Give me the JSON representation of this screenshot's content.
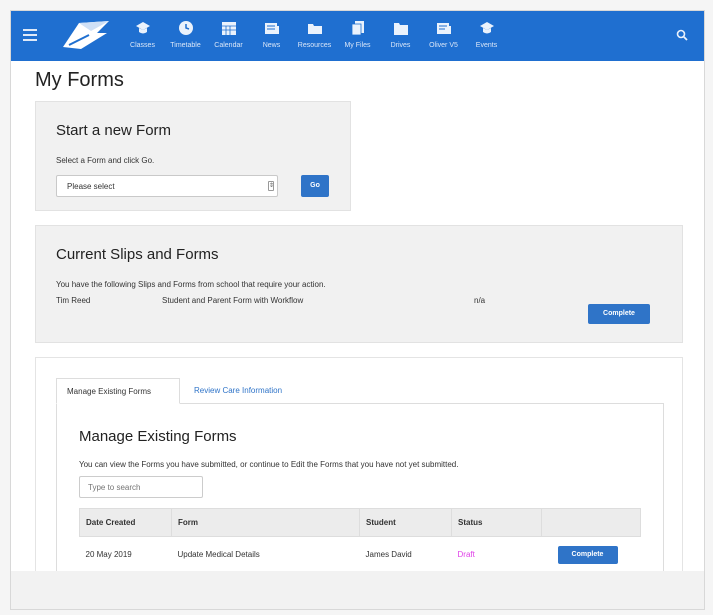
{
  "nav": {
    "items": [
      {
        "label": "Classes",
        "icon": "classes-icon"
      },
      {
        "label": "Timetable",
        "icon": "timetable-icon"
      },
      {
        "label": "Calendar",
        "icon": "calendar-icon"
      },
      {
        "label": "News",
        "icon": "news-icon"
      },
      {
        "label": "Resources",
        "icon": "resources-icon"
      },
      {
        "label": "My Files",
        "icon": "files-icon"
      },
      {
        "label": "Drives",
        "icon": "drives-icon"
      },
      {
        "label": "Oliver V5",
        "icon": "oliver-icon"
      },
      {
        "label": "Events",
        "icon": "events-icon"
      }
    ]
  },
  "page": {
    "title": "My Forms"
  },
  "new_form": {
    "heading": "Start a new Form",
    "hint": "Select a Form and click Go.",
    "select_value": "Please select",
    "go_label": "Go"
  },
  "slips": {
    "heading": "Current Slips and Forms",
    "description": "You have the following Slips and Forms from school that require your action.",
    "row": {
      "name": "Tim Reed",
      "form": "Student and Parent Form with Workflow",
      "status": "n/a",
      "action": "Complete"
    }
  },
  "manage": {
    "tabs": [
      {
        "label": "Manage Existing Forms"
      },
      {
        "label": "Review Care Information"
      }
    ],
    "heading": "Manage Existing Forms",
    "description": "You can view the Forms you have submitted, or continue to Edit the Forms that you have not yet submitted.",
    "search_placeholder": "Type to search",
    "columns": [
      "Date Created",
      "Form",
      "Student",
      "Status",
      ""
    ],
    "rows": [
      {
        "date": "20 May 2019",
        "form": "Update Medical Details",
        "student": "James David",
        "status": "Draft",
        "action": "Complete"
      }
    ]
  },
  "colors": {
    "brand": "#1f6fd0",
    "button": "#2f74c8",
    "draft": "#e040e8"
  }
}
